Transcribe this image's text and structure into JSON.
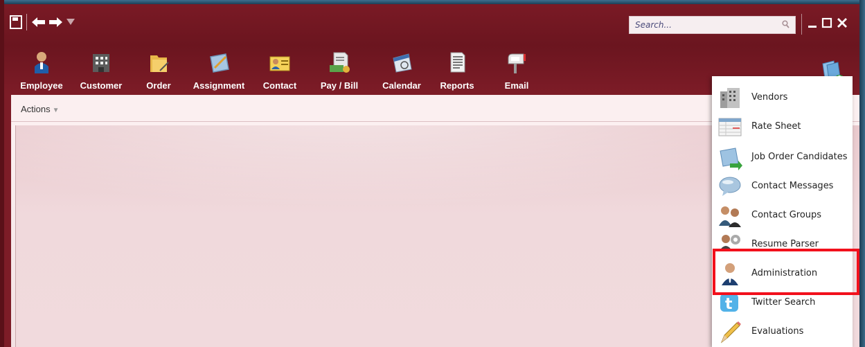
{
  "titlebar": {
    "icons": [
      "save-icon",
      "back-arrow-icon",
      "forward-arrow-icon",
      "dropdown-arrow-icon"
    ],
    "search_placeholder": "Search...",
    "window_controls": [
      "minimize-icon",
      "maximize-icon",
      "close-icon"
    ]
  },
  "toolbar": {
    "items": [
      {
        "label": "Employee",
        "icon": "employee-icon"
      },
      {
        "label": "Customer",
        "icon": "customer-building-icon"
      },
      {
        "label": "Order",
        "icon": "order-folder-icon"
      },
      {
        "label": "Assignment",
        "icon": "assignment-icon"
      },
      {
        "label": "Contact",
        "icon": "contact-card-icon"
      },
      {
        "label": "Pay / Bill",
        "icon": "pay-bill-icon"
      },
      {
        "label": "Calendar",
        "icon": "calendar-icon"
      },
      {
        "label": "Reports",
        "icon": "reports-icon"
      },
      {
        "label": "Email",
        "icon": "mailbox-icon"
      }
    ],
    "more_icon": "download-more-icon"
  },
  "actions_label": "Actions",
  "dropdown_menu": {
    "items": [
      {
        "label": "Vendors",
        "icon": "vendors-building-icon"
      },
      {
        "label": "Rate Sheet",
        "icon": "rate-sheet-icon"
      },
      {
        "label": "Job Order Candidates",
        "icon": "job-order-candidates-icon"
      },
      {
        "label": "Contact Messages",
        "icon": "speech-bubble-icon"
      },
      {
        "label": "Contact Groups",
        "icon": "contact-groups-icon"
      },
      {
        "label": "Resume Parser",
        "icon": "resume-parser-gear-icon"
      },
      {
        "label": "Administration",
        "icon": "administrator-icon"
      },
      {
        "label": "Twitter Search",
        "icon": "twitter-icon"
      },
      {
        "label": "Evaluations",
        "icon": "pencil-icon"
      }
    ],
    "highlighted_item": "Administration"
  },
  "colors": {
    "chrome": "#6b151f",
    "highlight_border": "#f2101c",
    "content_bg": "#f1dadd"
  }
}
